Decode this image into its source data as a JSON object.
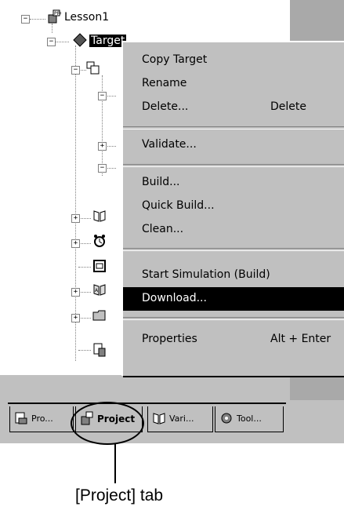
{
  "tree": {
    "root_label": "Lesson1",
    "target_label": "Target",
    "root_expander": "−",
    "target_expander": "−",
    "child_expanders": [
      "−",
      "−",
      "+",
      "−",
      "+",
      "+",
      "+",
      "+"
    ]
  },
  "context_menu": {
    "items": [
      {
        "label": "Copy Target",
        "shortcut": ""
      },
      {
        "label": "Rename",
        "shortcut": ""
      },
      {
        "label": "Delete...",
        "shortcut": "Delete"
      },
      {
        "label": "Validate...",
        "shortcut": ""
      },
      {
        "label": "Build...",
        "shortcut": ""
      },
      {
        "label": "Quick Build...",
        "shortcut": ""
      },
      {
        "label": "Clean...",
        "shortcut": ""
      },
      {
        "label": "Start Simulation (Build)",
        "shortcut": ""
      },
      {
        "label": "Download...",
        "shortcut": ""
      },
      {
        "label": "Properties",
        "shortcut": "Alt + Enter"
      }
    ],
    "highlighted_item": "Download..."
  },
  "tabs": [
    {
      "label": "Pro...",
      "icon": "program-icon"
    },
    {
      "label": "Project",
      "icon": "project-icon"
    },
    {
      "label": "Vari...",
      "icon": "variables-icon"
    },
    {
      "label": "Tool...",
      "icon": "toolbox-icon"
    }
  ],
  "active_tab": "Project",
  "caption": "[Project] tab",
  "colors": {
    "menu_bg": "#c0c0c0",
    "highlight": "#000000",
    "highlight_text": "#ffffff",
    "pane_gray": "#a9a9a9"
  }
}
